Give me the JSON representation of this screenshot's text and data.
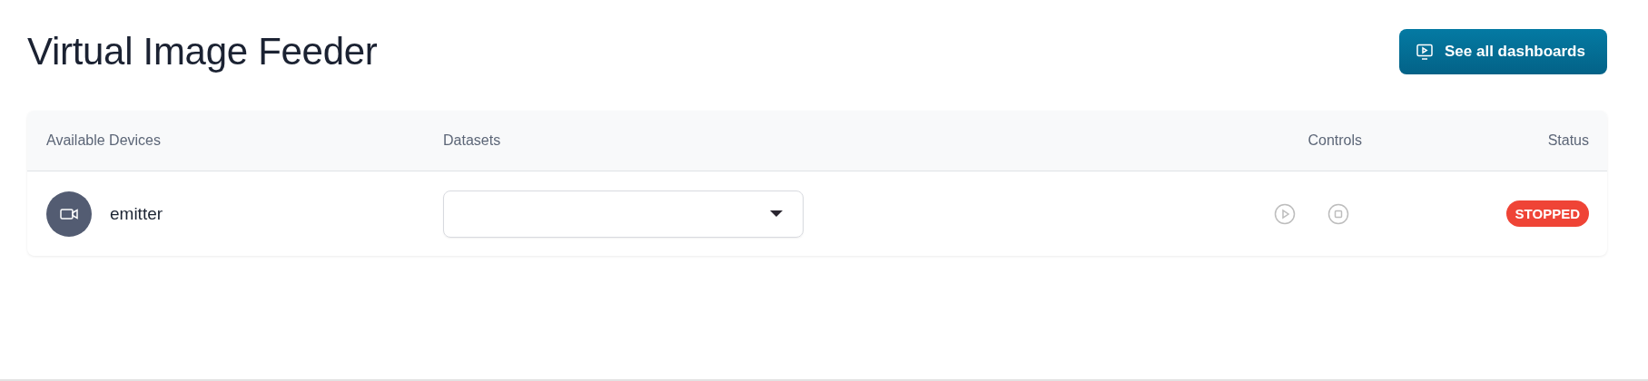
{
  "page": {
    "title": "Virtual Image Feeder"
  },
  "header_button": {
    "label": "See all dashboards"
  },
  "table": {
    "columns": [
      "Available Devices",
      "Datasets",
      "Controls",
      "Status"
    ],
    "rows": [
      {
        "device": "emitter",
        "controls": [
          {
            "kind": "play",
            "disabled": true
          },
          {
            "kind": "stop",
            "disabled": true
          }
        ],
        "status": "STOPPED"
      }
    ]
  }
}
